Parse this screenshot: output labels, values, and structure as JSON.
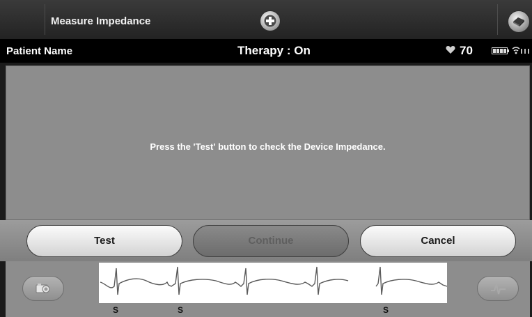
{
  "title_bar": {
    "title": "Measure Impedance",
    "icons": {
      "add": "plus-circle-icon",
      "menu": "device-menu-icon"
    }
  },
  "status_bar": {
    "patient_name": "Patient Name",
    "therapy": "Therapy : On",
    "heart_rate": "70",
    "icons": {
      "heart": "heart-icon",
      "battery": "battery-icon",
      "signal": "signal-icon",
      "bars": "signal-bars-icon"
    }
  },
  "message": {
    "text": "Press the 'Test' button to check the Device Impedance."
  },
  "buttons": {
    "test": "Test",
    "continue": "Continue",
    "cancel": "Cancel"
  },
  "ecg": {
    "sense_markers": [
      "S",
      "S",
      "S"
    ],
    "icons": {
      "left": "camera-snapshot-icon",
      "right": "ecg-zoom-icon"
    }
  },
  "colors": {
    "panel": "#8d8d8d",
    "header": "#2e2e2e",
    "status_bar": "#000000",
    "button_light": "#efefef",
    "button_disabled": "#7a7a7a"
  }
}
